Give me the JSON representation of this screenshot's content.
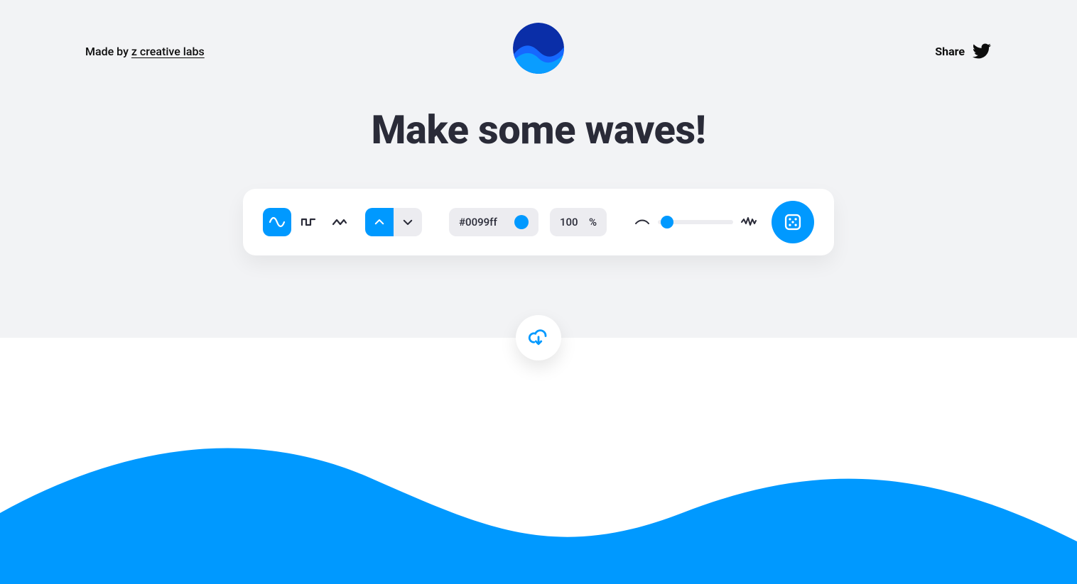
{
  "header": {
    "made_by_prefix": "Made by ",
    "made_by_link_text": "z creative labs",
    "share_label": "Share"
  },
  "hero": {
    "title": "Make some waves!"
  },
  "toolbar": {
    "shapes": {
      "sine_active": true,
      "square_active": false,
      "zigzag_active": false
    },
    "direction": {
      "up_active": true,
      "down_active": false
    },
    "color_hex": "#0099ff",
    "opacity_value": "100",
    "opacity_unit": "%",
    "complexity_slider_percent": 12
  },
  "colors": {
    "accent": "#0099ff",
    "bg": "#f2f3f5",
    "panel": "#ffffff",
    "chip": "#ececf0",
    "text": "#2a2b38"
  }
}
